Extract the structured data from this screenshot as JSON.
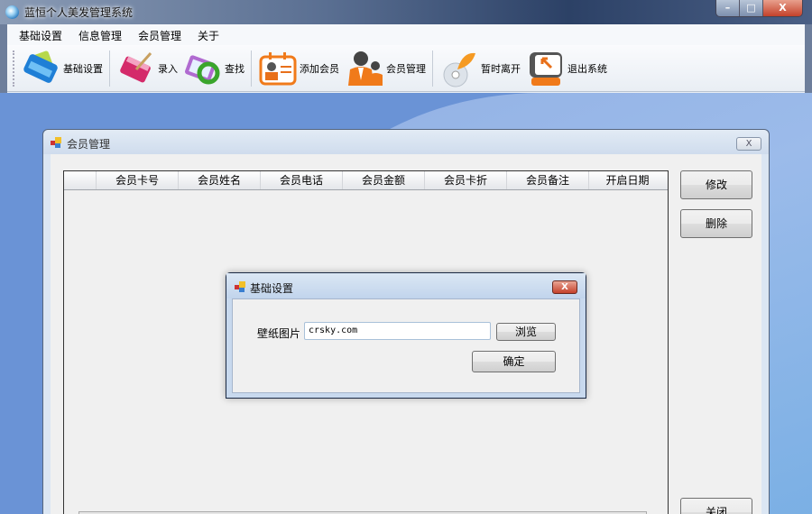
{
  "window": {
    "title": "蓝恒个人美发管理系统",
    "minimize": "–",
    "maximize": "□",
    "close": "X"
  },
  "menu": [
    "基础设置",
    "信息管理",
    "会员管理",
    "关于"
  ],
  "toolbar": [
    {
      "label": "基础设置",
      "icon": "binder-icon"
    },
    {
      "label": "录入",
      "icon": "book-pen-icon"
    },
    {
      "label": "查找",
      "icon": "clipboard-refresh-icon"
    },
    {
      "label": "添加会员",
      "icon": "id-card-icon"
    },
    {
      "label": "会员管理",
      "icon": "users-icon"
    },
    {
      "label": "暂时离开",
      "icon": "cd-butterfly-icon"
    },
    {
      "label": "退出系统",
      "icon": "monitor-exit-icon"
    }
  ],
  "member_window": {
    "title": "会员管理",
    "close": "X",
    "columns": [
      "会员卡号",
      "会员姓名",
      "会员电话",
      "会员金额",
      "会员卡折",
      "会员备注",
      "开启日期"
    ],
    "buttons": {
      "edit": "修改",
      "delete": "删除",
      "close": "关闭"
    }
  },
  "settings_dialog": {
    "title": "基础设置",
    "close": "X",
    "wallpaper_label": "壁纸图片",
    "wallpaper_value": "crsky.com",
    "browse": "浏览",
    "ok": "确定"
  }
}
